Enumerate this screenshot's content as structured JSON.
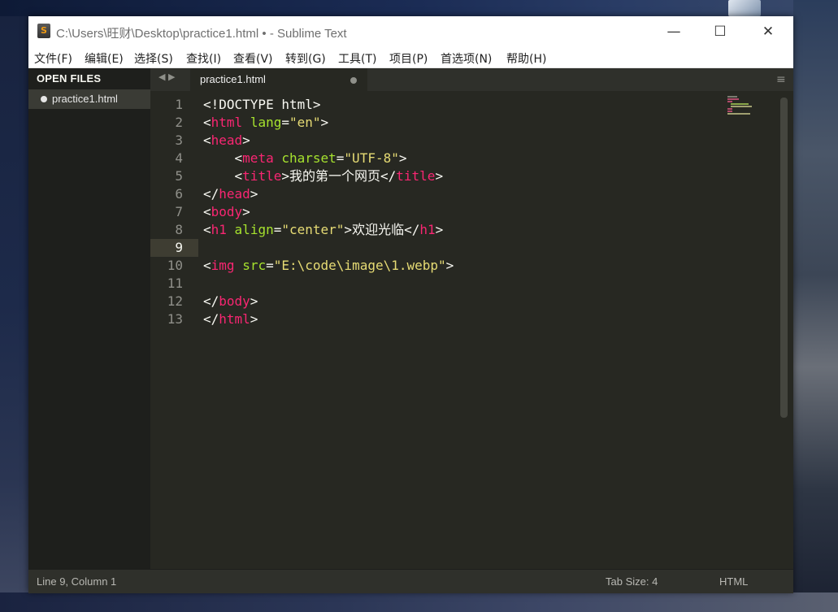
{
  "window": {
    "title": "C:\\Users\\旺财\\Desktop\\practice1.html • - Sublime Text",
    "minimize": "—",
    "maximize": "☐",
    "close": "✕"
  },
  "menubar": [
    {
      "label": "文件(F)"
    },
    {
      "label": "编辑(E)"
    },
    {
      "label": "选择(S)"
    },
    {
      "label": "查找(I)"
    },
    {
      "label": "查看(V)"
    },
    {
      "label": "转到(G)"
    },
    {
      "label": "工具(T)"
    },
    {
      "label": "项目(P)"
    },
    {
      "label": "首选项(N)"
    },
    {
      "label": "帮助(H)"
    }
  ],
  "sidebar": {
    "header": "OPEN FILES",
    "files": [
      {
        "name": "practice1.html",
        "modified": true
      }
    ]
  },
  "tabs": {
    "arrows": "◀ ▶",
    "active": {
      "label": "practice1.html",
      "modified": true
    },
    "menu_icon": "≡"
  },
  "editor": {
    "current_line": 9,
    "lines": [
      {
        "n": "1"
      },
      {
        "n": "2"
      },
      {
        "n": "3"
      },
      {
        "n": "4"
      },
      {
        "n": "5"
      },
      {
        "n": "6"
      },
      {
        "n": "7"
      },
      {
        "n": "8"
      },
      {
        "n": "9"
      },
      {
        "n": "10"
      },
      {
        "n": "11"
      },
      {
        "n": "12"
      },
      {
        "n": "13"
      }
    ],
    "tokens": {
      "l1_a": "<!DOCTYPE html>",
      "l2_lt": "<",
      "l2_tag": "html",
      "l2_attr": "lang",
      "l2_eq": "=",
      "l2_val": "\"en\"",
      "l2_gt": ">",
      "l3_lt": "<",
      "l3_tag": "head",
      "l3_gt": ">",
      "l4_lt": "<",
      "l4_tag": "meta",
      "l4_attr": "charset",
      "l4_eq": "=",
      "l4_val": "\"UTF-8\"",
      "l4_gt": ">",
      "l5_lt": "<",
      "l5_tag": "title",
      "l5_gt": ">",
      "l5_text": "我的第一个网页",
      "l5_lt2": "</",
      "l5_tag2": "title",
      "l5_gt2": ">",
      "l6_lt": "</",
      "l6_tag": "head",
      "l6_gt": ">",
      "l7_lt": "<",
      "l7_tag": "body",
      "l7_gt": ">",
      "l8_lt": "<",
      "l8_tag": "h1",
      "l8_attr": "align",
      "l8_eq": "=",
      "l8_val": "\"center\"",
      "l8_gt": ">",
      "l8_text": "欢迎光临",
      "l8_lt2": "</",
      "l8_tag2": "h1",
      "l8_gt2": ">",
      "l10_lt": "<",
      "l10_tag": "img",
      "l10_attr": "src",
      "l10_eq": "=",
      "l10_val": "\"E:\\code\\image\\1.webp\"",
      "l10_gt": ">",
      "l12_lt": "</",
      "l12_tag": "body",
      "l12_gt": ">",
      "l13_lt": "</",
      "l13_tag": "html",
      "l13_gt": ">"
    }
  },
  "statusbar": {
    "position": "Line 9, Column 1",
    "tab_size": "Tab Size: 4",
    "syntax": "HTML"
  },
  "colors": {
    "background": "#272822",
    "tag": "#f92672",
    "attribute": "#a6e22e",
    "string": "#e6db74",
    "text": "#f8f8f2"
  }
}
